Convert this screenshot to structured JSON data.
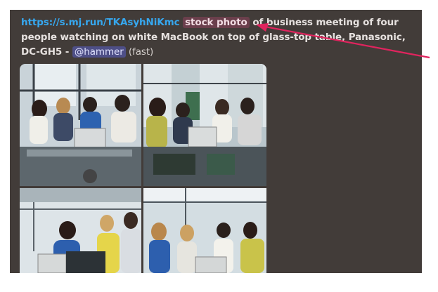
{
  "message": {
    "link_text": "https://s.mj.run/TKAsyhNiKmc",
    "highlight_text": "stock photo",
    "prompt_text": " of business meeting of four people watching on white MacBook on top of glass-top table, Panasonic, DC-GH5 - ",
    "mention_text": "@hammer",
    "mode_text": " (fast)"
  },
  "colors": {
    "panel_bg": "#423c39",
    "link": "#36a8f0",
    "highlight_bg": "#6b3f4c",
    "mention_bg": "#4e4f87",
    "annotation_arrow": "#e0245e"
  },
  "images": [
    {
      "description": "generated image 1"
    },
    {
      "description": "generated image 2"
    },
    {
      "description": "generated image 3"
    },
    {
      "description": "generated image 4"
    }
  ]
}
